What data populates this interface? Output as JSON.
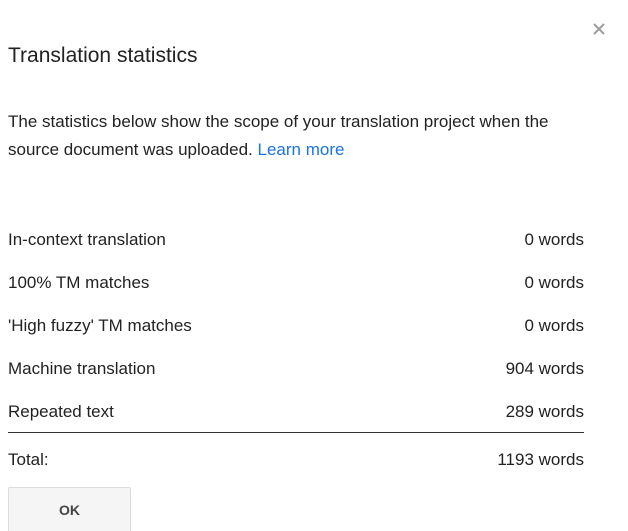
{
  "dialog": {
    "title": "Translation statistics",
    "close_icon": "close-icon",
    "description_text": "The statistics below show the scope of your translation project when the source document was uploaded. ",
    "learn_more_label": "Learn more",
    "stats": [
      {
        "label": "In-context translation",
        "value": "0 words"
      },
      {
        "label": "100% TM matches",
        "value": "0 words"
      },
      {
        "label": "'High fuzzy' TM matches",
        "value": "0 words"
      },
      {
        "label": "Machine translation",
        "value": "904 words"
      },
      {
        "label": "Repeated text",
        "value": "289 words"
      }
    ],
    "total_label": "Total:",
    "total_value": "1193 words",
    "ok_label": "OK"
  },
  "colors": {
    "link": "#1a73e8",
    "text": "#222222",
    "close_icon": "#9e9e9e"
  }
}
